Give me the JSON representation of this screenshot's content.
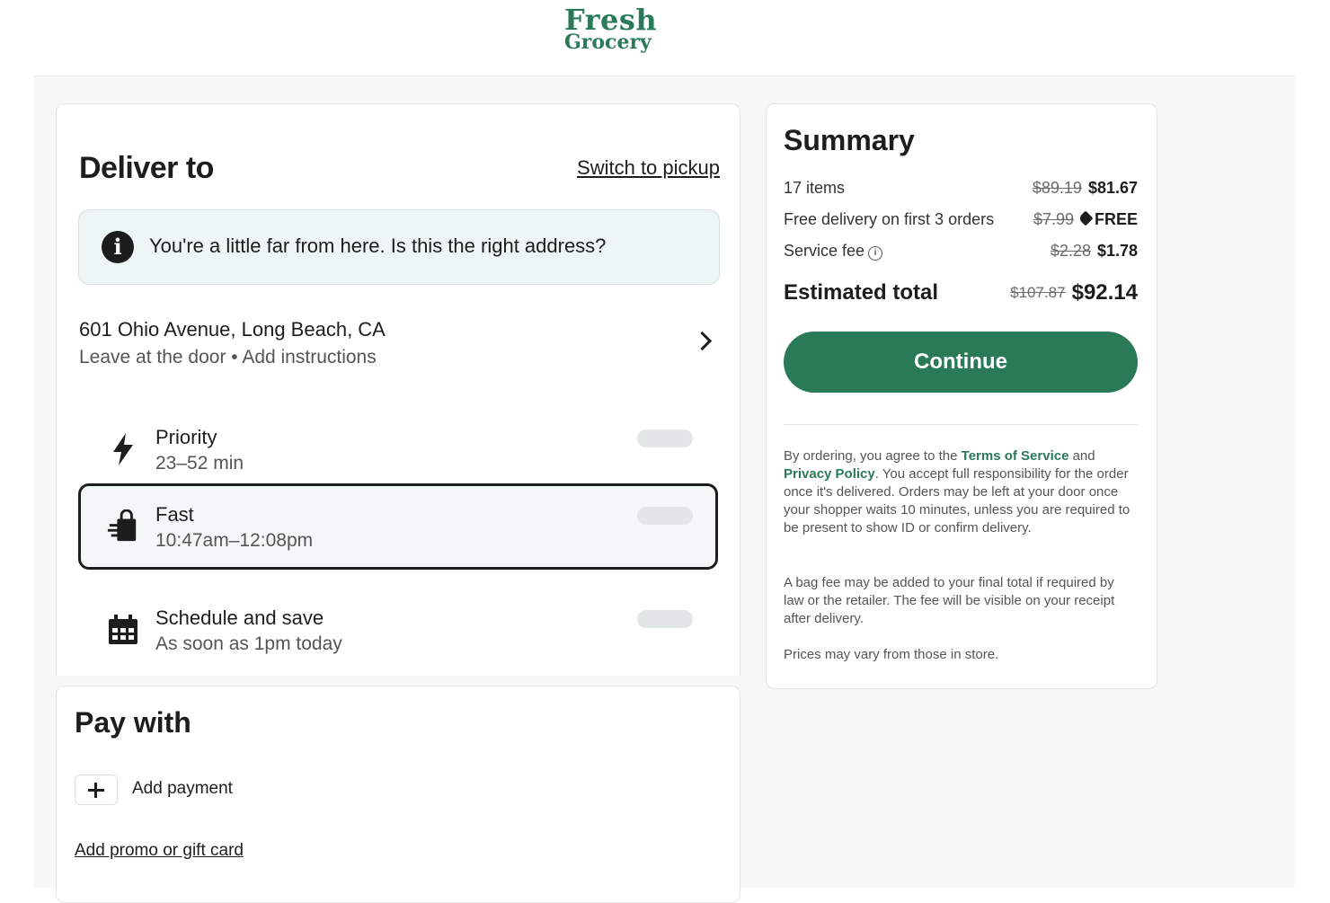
{
  "brand": {
    "line1": "Fresh",
    "line2": "Grocery",
    "color": "#2a7a57"
  },
  "deliver": {
    "title": "Deliver to",
    "switch_label": "Switch to pickup",
    "notice": "You're a little far from here. Is this the right address?",
    "address": "601 Ohio Avenue, Long Beach, CA",
    "address_sub": "Leave at the door • Add instructions",
    "options": [
      {
        "name": "Priority",
        "detail": "23–52 min",
        "icon": "lightning-icon",
        "selected": false
      },
      {
        "name": "Fast",
        "detail": "10:47am–12:08pm",
        "icon": "shopping-bag-icon",
        "selected": true
      },
      {
        "name": "Schedule and save",
        "detail": "As soon as 1pm today",
        "icon": "calendar-icon",
        "selected": false
      }
    ]
  },
  "pay": {
    "title": "Pay with",
    "add_payment": "Add payment",
    "promo": "Add promo or gift card"
  },
  "summary": {
    "title": "Summary",
    "items_label": "17 items",
    "items_old": "$89.19",
    "items_new": "$81.67",
    "delivery_label": "Free delivery on first 3 orders",
    "delivery_old": "$7.99",
    "delivery_new": "FREE",
    "service_label": "Service fee",
    "service_old": "$2.28",
    "service_new": "$1.78",
    "total_label": "Estimated total",
    "total_old": "$107.87",
    "total_new": "$92.14",
    "continue": "Continue",
    "legal1_pre": "By ordering, you agree to the",
    "terms": "Terms of Service",
    "legal1_and": "and",
    "privacy": "Privacy Policy",
    "legal1_post": ". You accept full responsibility for the order once it's delivered. Orders may be left at your door once your shopper waits 10 minutes, unless you are required to be present to show ID or confirm delivery.",
    "legal2": "A bag fee may be added to your final total if required by law or the retailer. The fee will be visible on your receipt after delivery.",
    "legal3": "Prices may vary from those in store."
  }
}
